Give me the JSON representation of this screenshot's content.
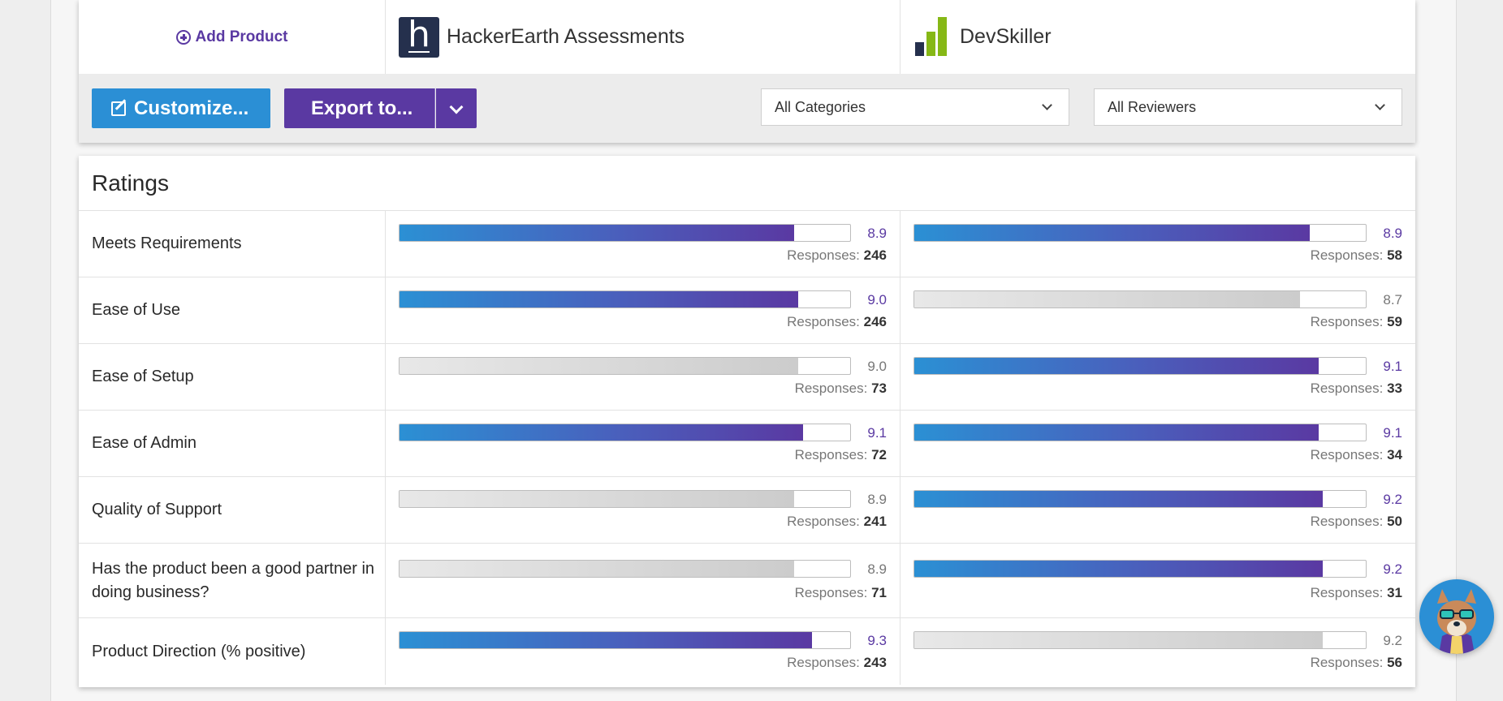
{
  "header": {
    "add_product_label": "Add Product",
    "products": [
      {
        "name": "HackerEarth Assessments",
        "logo": "hackerearth-logo"
      },
      {
        "name": "DevSkiller",
        "logo": "devskiller-logo"
      }
    ]
  },
  "controls": {
    "customize_label": "Customize...",
    "export_label": "Export to...",
    "category_select": "All Categories",
    "reviewer_select": "All Reviewers"
  },
  "colors": {
    "accent_purple": "#5a39a2",
    "accent_blue": "#2b8fd5"
  },
  "ratings": {
    "title": "Ratings",
    "responses_label": "Responses:",
    "rows": [
      {
        "label": "Meets Requirements",
        "cells": [
          {
            "score": "8.9",
            "responses": "246",
            "winner": true
          },
          {
            "score": "8.9",
            "responses": "58",
            "winner": true
          }
        ]
      },
      {
        "label": "Ease of Use",
        "cells": [
          {
            "score": "9.0",
            "responses": "246",
            "winner": true
          },
          {
            "score": "8.7",
            "responses": "59",
            "winner": false
          }
        ]
      },
      {
        "label": "Ease of Setup",
        "cells": [
          {
            "score": "9.0",
            "responses": "73",
            "winner": false
          },
          {
            "score": "9.1",
            "responses": "33",
            "winner": true
          }
        ]
      },
      {
        "label": "Ease of Admin",
        "cells": [
          {
            "score": "9.1",
            "responses": "72",
            "winner": true
          },
          {
            "score": "9.1",
            "responses": "34",
            "winner": true
          }
        ]
      },
      {
        "label": "Quality of Support",
        "cells": [
          {
            "score": "8.9",
            "responses": "241",
            "winner": false
          },
          {
            "score": "9.2",
            "responses": "50",
            "winner": true
          }
        ]
      },
      {
        "label": "Has the product been a good partner in doing business?",
        "cells": [
          {
            "score": "8.9",
            "responses": "71",
            "winner": false
          },
          {
            "score": "9.2",
            "responses": "31",
            "winner": true
          }
        ]
      },
      {
        "label": "Product Direction (% positive)",
        "cells": [
          {
            "score": "9.3",
            "responses": "243",
            "winner": true
          },
          {
            "score": "9.2",
            "responses": "56",
            "winner": false
          }
        ]
      }
    ]
  },
  "chat_widget": {
    "icon": "mascot-chat-icon"
  }
}
